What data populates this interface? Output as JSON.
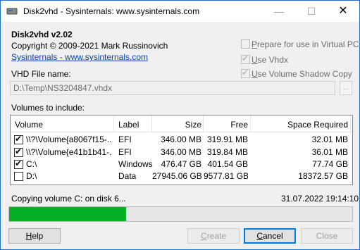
{
  "window": {
    "title": "Disk2vhd - Sysinternals: www.sysinternals.com",
    "minimize": "—",
    "maximize": "☐",
    "close": "✕"
  },
  "header": {
    "app_name": "Disk2vhd v2.02",
    "copyright": "Copyright  © 2009-2021 Mark Russinovich",
    "link": "Sysinternals - www.sysinternals.com"
  },
  "options": [
    {
      "pre": "",
      "accel": "P",
      "post": "repare for use in Virtual PC",
      "checked": false,
      "enabled": false
    },
    {
      "pre": "",
      "accel": "U",
      "post": "se Vhdx",
      "checked": true,
      "enabled": false
    },
    {
      "pre": "",
      "accel": "U",
      "post": "se Volume Shadow Copy",
      "checked": true,
      "enabled": false
    }
  ],
  "vhd": {
    "label": "VHD File name:",
    "value": "D:\\Temp\\NS3204847.vhdx",
    "browse": "..."
  },
  "volumes": {
    "label": "Volumes to include:",
    "columns": [
      "Volume",
      "Label",
      "Size",
      "Free",
      "Space Required"
    ],
    "rows": [
      {
        "checked": true,
        "volume": "\\\\?\\Volume{a8067f15-...",
        "label": "EFI",
        "size": "346.00 MB",
        "free": "319.91 MB",
        "required": "32.01 MB"
      },
      {
        "checked": true,
        "volume": "\\\\?\\Volume{e41b1b41-...",
        "label": "EFI",
        "size": "346.00 MB",
        "free": "319.84 MB",
        "required": "36.01 MB"
      },
      {
        "checked": true,
        "volume": "C:\\",
        "label": "Windows",
        "size": "476.47 GB",
        "free": "401.54 GB",
        "required": "77.74 GB"
      },
      {
        "checked": false,
        "volume": "D:\\",
        "label": "Data",
        "size": "27945.06 GB",
        "free": "9577.81 GB",
        "required": "18372.57 GB"
      }
    ]
  },
  "status": {
    "text": "Copying volume C: on disk 6...",
    "time": "31.07.2022 19:14:10",
    "progress": 0.34
  },
  "buttons": {
    "help": {
      "accel": "H",
      "rest": "elp"
    },
    "create": {
      "accel": "C",
      "rest": "reate"
    },
    "cancel": {
      "accel": "C",
      "rest": "ancel"
    },
    "close": "Close"
  },
  "colors": {
    "progress": "#06b025",
    "link": "#0645ad",
    "focus": "#0078d7"
  }
}
